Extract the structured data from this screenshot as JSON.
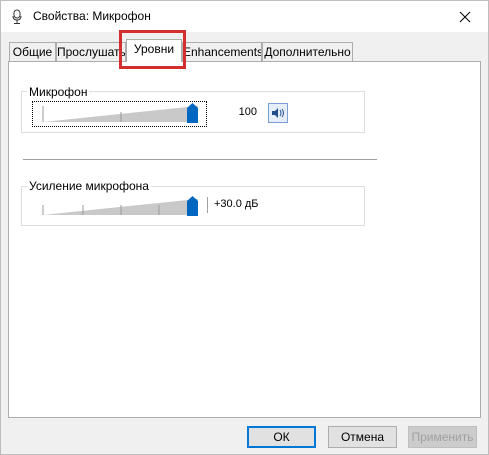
{
  "window": {
    "title": "Свойства: Микрофон",
    "icon": "microphone-icon",
    "close_icon": "close-icon"
  },
  "tabs": [
    {
      "label": "Общие",
      "active": false
    },
    {
      "label": "Прослушать",
      "active": false
    },
    {
      "label": "Уровни",
      "active": true
    },
    {
      "label": "Enhancements",
      "active": false
    },
    {
      "label": "Дополнительно",
      "active": false
    }
  ],
  "levels": {
    "microphone": {
      "label": "Микрофон",
      "value": "100",
      "level": 1.0,
      "mute_icon": "speaker-icon"
    },
    "boost": {
      "label": "Усиление микрофона",
      "value": "+30.0 дБ",
      "level": 1.0
    }
  },
  "buttons": {
    "ok": "ОК",
    "cancel": "Отмена",
    "apply": "Применить"
  },
  "colors": {
    "highlight": "#d32f2f",
    "thumb": "#0067c0",
    "default_button_border": "#0078d7"
  }
}
